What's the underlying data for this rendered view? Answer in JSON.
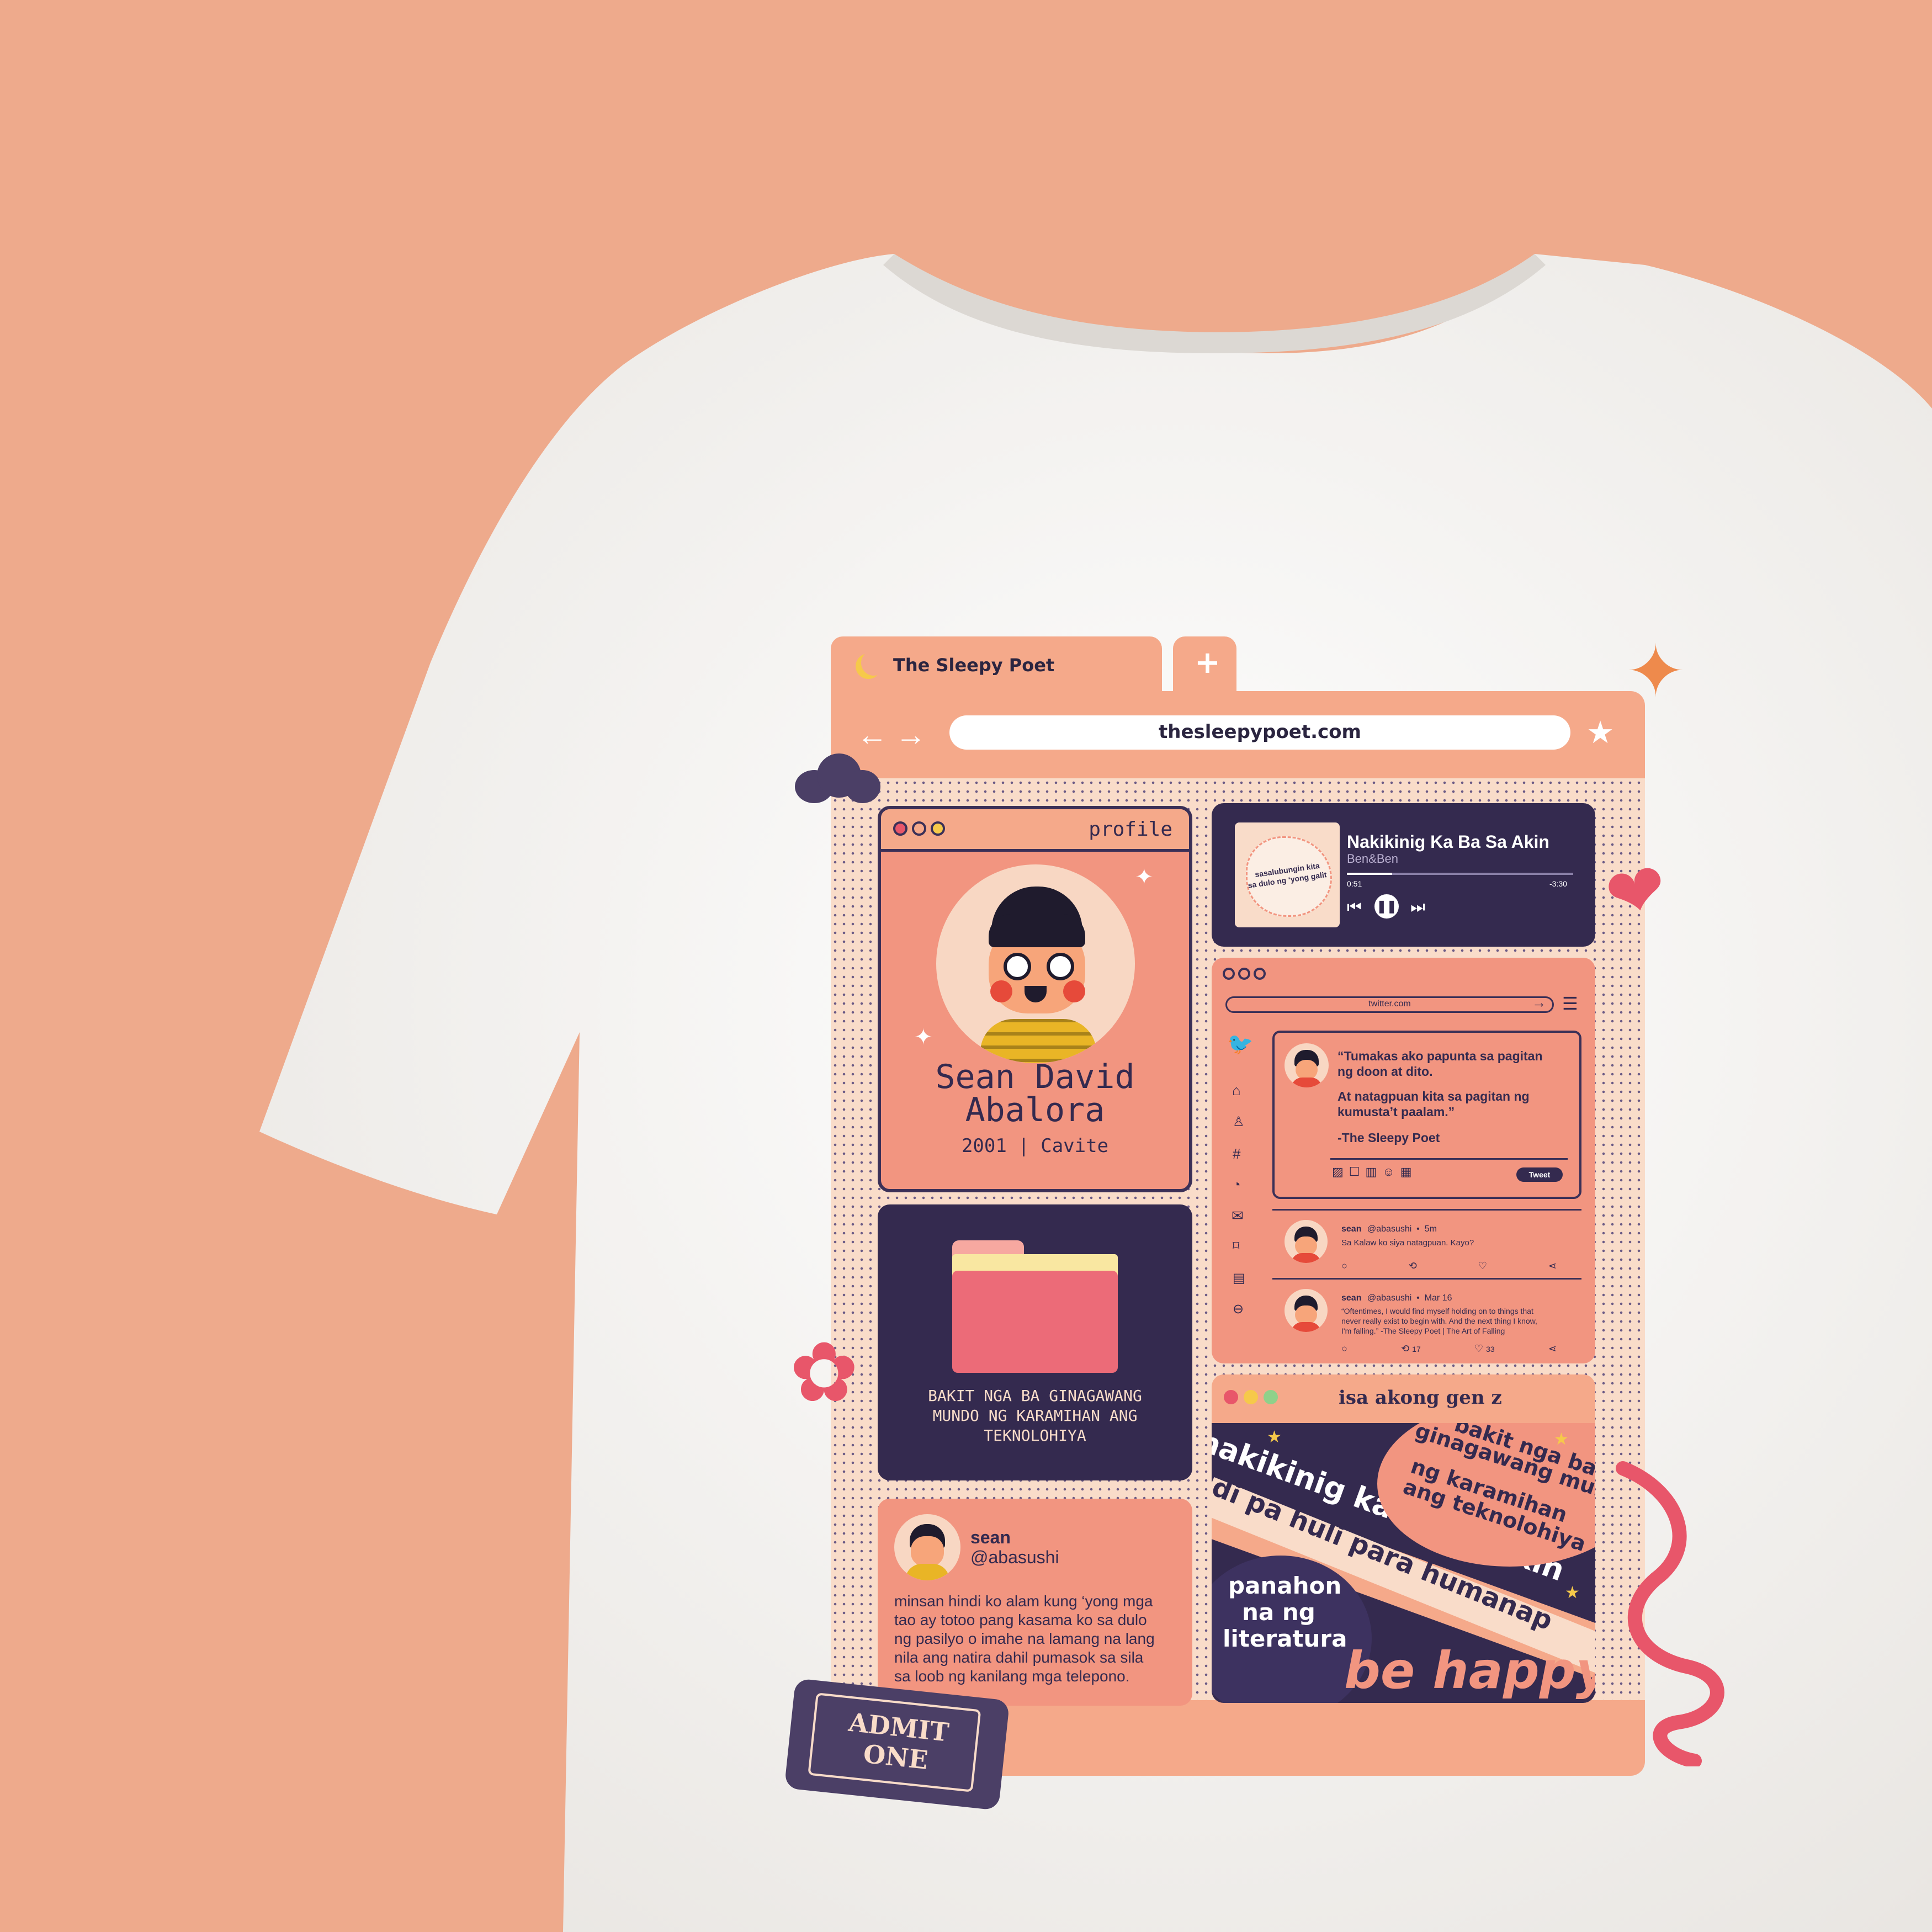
{
  "browser": {
    "tab_title": "The Sleepy Poet",
    "new_tab_glyph": "+",
    "url": "thesleepypoet.com",
    "back_forward_glyph": "← →",
    "bookmark_glyph": "★"
  },
  "profile": {
    "header": "profile",
    "name_line1": "Sean David",
    "name_line2": "Abalora",
    "meta": "2001 | Cavite"
  },
  "folder": {
    "caption_line1": "BAKIT NGA BA GINAGAWANG",
    "caption_line2": "MUNDO NG KARAMIHAN ANG",
    "caption_line3": "TEKNOLOHIYA"
  },
  "post": {
    "name": "sean",
    "handle": "@abasushi",
    "body_line1": "minsan hindi ko alam kung ‘yong mga",
    "body_line2": "tao ay totoo pang kasama ko sa dulo",
    "body_line3": "ng pasilyo o imahe na lamang na lang",
    "body_line4": "nila ang natira dahil pumasok sa sila",
    "body_line5": "sa loob ng kanilang mga telepono."
  },
  "player": {
    "song": "Nakikinig Ka Ba Sa Akin",
    "artist": "Ben&Ben",
    "cover_text_line1": "sasalubungin kita",
    "cover_text_line2": "sa dulo ng ‘yong galit",
    "elapsed": "0:51",
    "remaining": "-3:30",
    "progress": 0.2
  },
  "twitter": {
    "url": "twitter.com",
    "compose_line1": "“Tumakas ako papunta sa pagitan",
    "compose_line2": "ng doon at dito.",
    "compose_line3": "At natagpuan kita sa pagitan ng",
    "compose_line4": "kumusta’t paalam.”",
    "compose_line5": "-The Sleepy Poet",
    "tweet_button": "Tweet",
    "tweets": [
      {
        "name": "sean",
        "meta": "@abasushi  •  5m",
        "text_line1": "Sa Kalaw ko siya natagpuan. Kayo?",
        "text_line2": "",
        "text_line3": "",
        "retweets": "",
        "likes": ""
      },
      {
        "name": "sean",
        "meta": "@abasushi  •  Mar 16",
        "text_line1": "“Oftentimes, I would find myself holding on to things that",
        "text_line2": "never really exist to begin with. And the next thing I know,",
        "text_line3": "I'm falling.” -The Sleepy Poet | The Art of Falling",
        "retweets": "17",
        "likes": "33"
      }
    ]
  },
  "genz": {
    "header": "isa akong gen z",
    "band1": "nakikinig ka ba sa akin",
    "band2_line1": "bakit nga ba",
    "band2_line2": "ginagawang mundo",
    "band2_line3": "ng karamihan",
    "band2_line4": "ang teknolohiya",
    "band3": "'di pa huli para humanap",
    "corner_line1": "panahon",
    "corner_line2": "na ng",
    "corner_line3": "literatura",
    "be_happy": "be happy"
  },
  "ticket": {
    "line1": "ADMIT",
    "line2": "ONE"
  },
  "colors": {
    "background": "#eeaa8c",
    "shirt": "#f7f6f4",
    "browser_peach": "#f5a98a",
    "panel_salmon": "#f29580",
    "navy": "#342a4f",
    "cream": "#f9dcc9",
    "pink_accent": "#e8566a"
  },
  "icons": [
    "moon-icon",
    "plus-icon",
    "back-arrow-icon",
    "forward-arrow-icon",
    "star-icon",
    "cloud-icon",
    "sparkle-icon",
    "heart-icon",
    "flower-icon",
    "ribbon-icon",
    "twitter-bird-icon",
    "home-icon",
    "user-icon",
    "hashtag-icon",
    "bell-icon",
    "mail-icon",
    "bookmark-icon",
    "list-icon",
    "more-icon",
    "pause-icon",
    "prev-icon",
    "next-icon",
    "folder-icon",
    "avatar-icon",
    "ticket-icon"
  ]
}
